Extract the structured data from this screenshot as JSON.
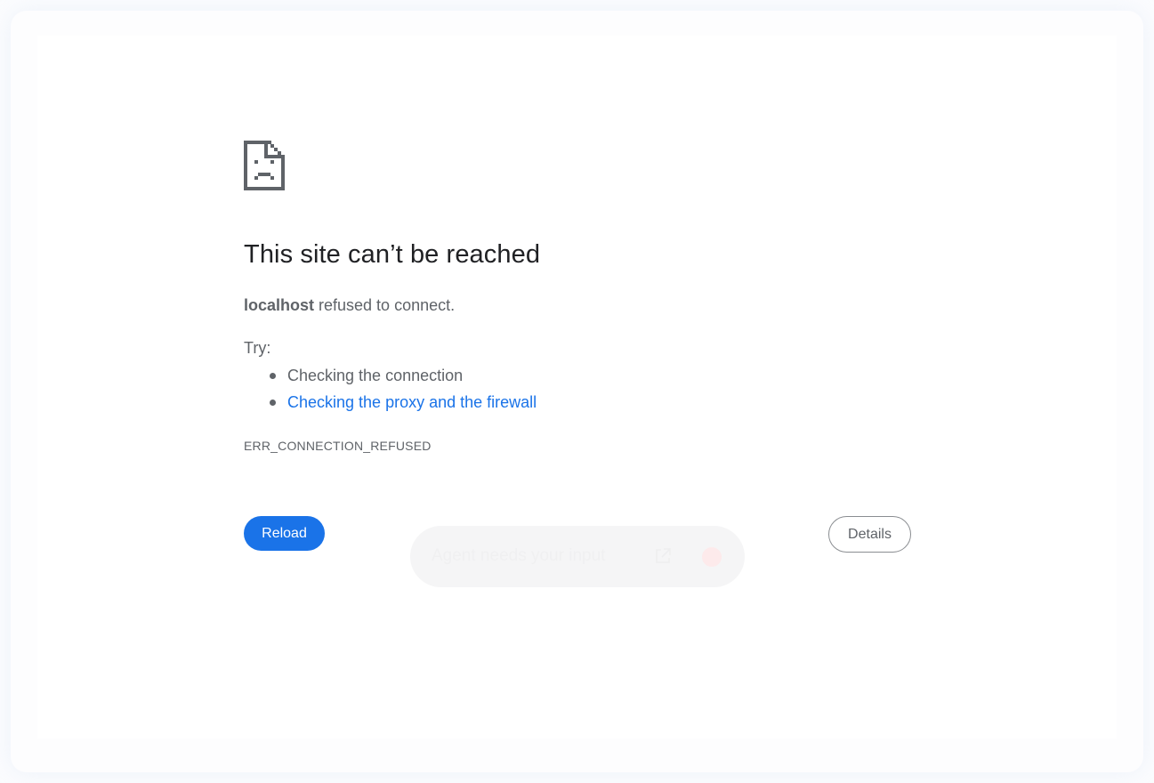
{
  "error_page": {
    "title": "This site can’t be reached",
    "host": "localhost",
    "summary_suffix": " refused to connect.",
    "try_label": "Try:",
    "suggestions": [
      {
        "text": "Checking the connection",
        "is_link": false
      },
      {
        "text": "Checking the proxy and the firewall",
        "is_link": true
      }
    ],
    "error_code": "ERR_CONNECTION_REFUSED",
    "reload_label": "Reload",
    "details_label": "Details",
    "icon": "sad-page-icon"
  },
  "agent_toast": {
    "message": "Agent needs your input",
    "open_icon": "open-external-icon",
    "stop_icon": "stop-icon"
  },
  "colors": {
    "accent": "#1a73e8",
    "title_text": "#202124",
    "body_text": "#5f6368"
  }
}
